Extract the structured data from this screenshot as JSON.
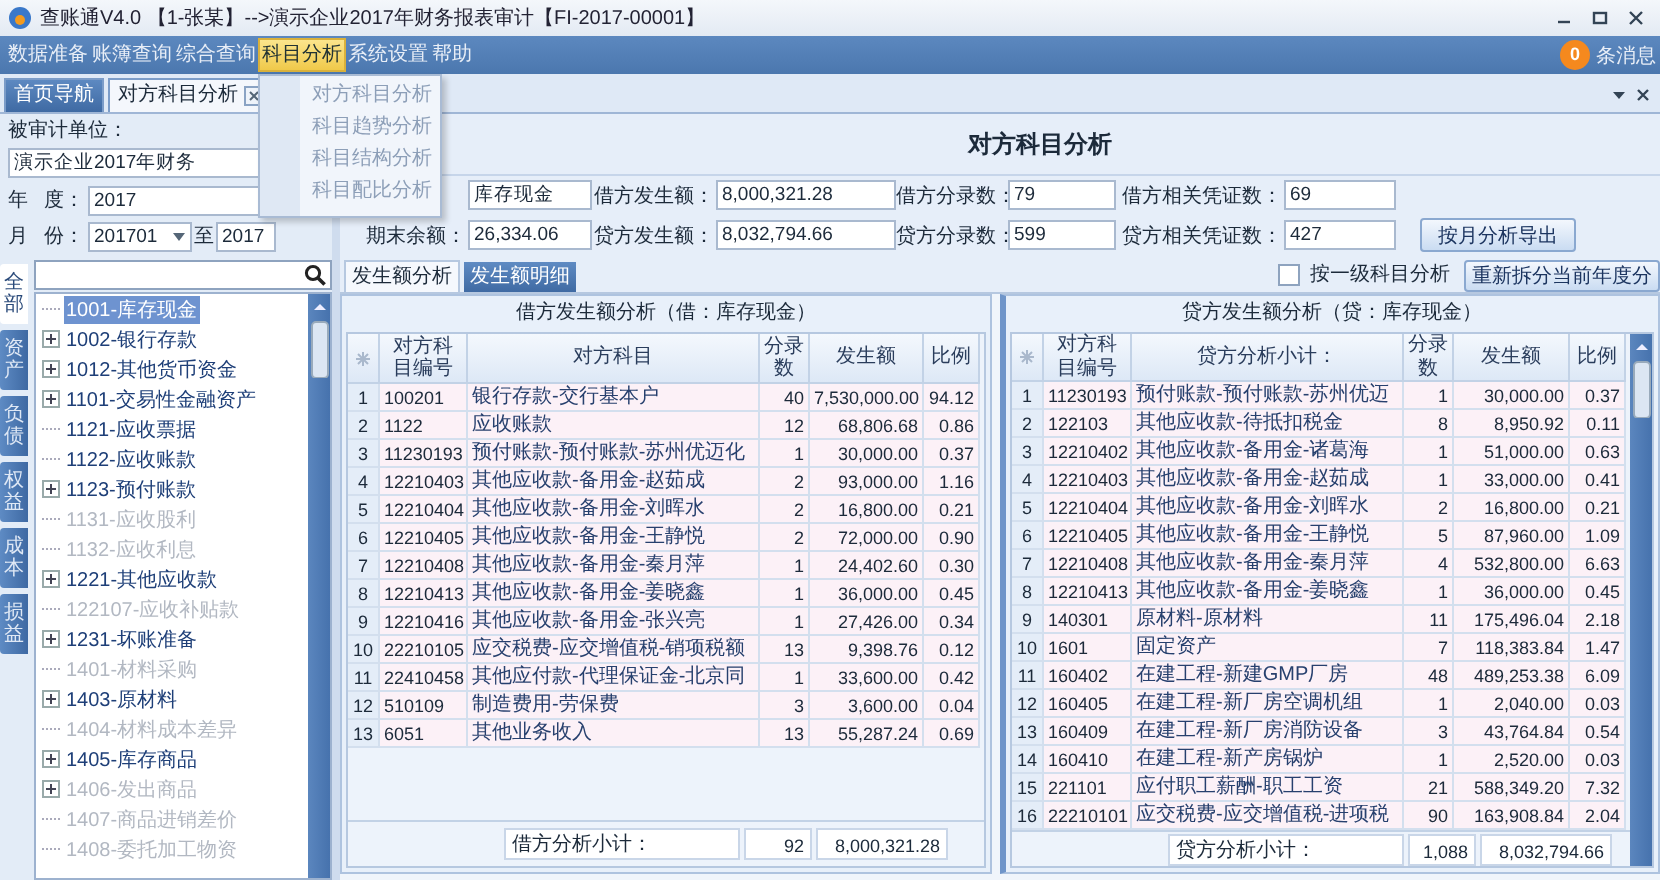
{
  "window": {
    "title": "查账通V4.0 【1-张某】-->演示企业2017年财务报表审计【FI-2017-00001】"
  },
  "menu": [
    {
      "label": "数据准备",
      "selected": false
    },
    {
      "label": "账簿查询",
      "selected": false
    },
    {
      "label": "综合查询",
      "selected": false
    },
    {
      "label": "科目分析",
      "selected": true
    },
    {
      "label": "系统设置",
      "selected": false
    },
    {
      "label": "帮助",
      "selected": false
    }
  ],
  "menu_dropdown": [
    "对方科目分析",
    "科目趋势分析",
    "科目结构分析",
    "科目配比分析"
  ],
  "messages": {
    "count": "0",
    "label": "条消息"
  },
  "doc_tabs": [
    {
      "label": "首页导航",
      "selected": false,
      "closable": false
    },
    {
      "label": "对方科目分析",
      "selected": true,
      "closable": true
    }
  ],
  "filters": {
    "unit": {
      "label": "被审计单位：",
      "value": "演示企业2017年财务"
    },
    "year": {
      "label_start": "年",
      "label_end": "度：",
      "value": "2017"
    },
    "month": {
      "label_start": "月",
      "label_end": "份：",
      "from": "201701",
      "separator": "至",
      "to": "2017"
    }
  },
  "category_tabs": [
    {
      "label": "全部",
      "selected": true
    },
    {
      "label": "资产",
      "selected": false
    },
    {
      "label": "负债",
      "selected": false
    },
    {
      "label": "权益",
      "selected": false
    },
    {
      "label": "成本",
      "selected": false
    },
    {
      "label": "损益",
      "selected": false
    }
  ],
  "tree": [
    {
      "label": "1001-库存现金",
      "expandable": false,
      "disabled": false,
      "selected": true
    },
    {
      "label": "1002-银行存款",
      "expandable": true,
      "disabled": false,
      "selected": false
    },
    {
      "label": "1012-其他货币资金",
      "expandable": true,
      "disabled": false,
      "selected": false
    },
    {
      "label": "1101-交易性金融资产",
      "expandable": true,
      "disabled": false,
      "selected": false
    },
    {
      "label": "1121-应收票据",
      "expandable": false,
      "disabled": false,
      "selected": false
    },
    {
      "label": "1122-应收账款",
      "expandable": false,
      "disabled": false,
      "selected": false
    },
    {
      "label": "1123-预付账款",
      "expandable": true,
      "disabled": false,
      "selected": false
    },
    {
      "label": "1131-应收股利",
      "expandable": false,
      "disabled": true,
      "selected": false
    },
    {
      "label": "1132-应收利息",
      "expandable": false,
      "disabled": true,
      "selected": false
    },
    {
      "label": "1221-其他应收款",
      "expandable": true,
      "disabled": false,
      "selected": false
    },
    {
      "label": "122107-应收补贴款",
      "expandable": false,
      "disabled": true,
      "selected": false
    },
    {
      "label": "1231-坏账准备",
      "expandable": true,
      "disabled": false,
      "selected": false
    },
    {
      "label": "1401-材料采购",
      "expandable": false,
      "disabled": true,
      "selected": false
    },
    {
      "label": "1403-原材料",
      "expandable": true,
      "disabled": false,
      "selected": false
    },
    {
      "label": "1404-材料成本差异",
      "expandable": false,
      "disabled": true,
      "selected": false
    },
    {
      "label": "1405-库存商品",
      "expandable": true,
      "disabled": false,
      "selected": false
    },
    {
      "label": "1406-发出商品",
      "expandable": true,
      "disabled": true,
      "selected": false
    },
    {
      "label": "1407-商品进销差价",
      "expandable": false,
      "disabled": true,
      "selected": false
    },
    {
      "label": "1408-委托加工物资",
      "expandable": false,
      "disabled": true,
      "selected": false
    }
  ],
  "analysis": {
    "title": "对方科目分析",
    "fields": [
      [
        {
          "value": "库存现金"
        },
        {
          "label": "借方发生额：",
          "value": "8,000,321.28"
        },
        {
          "label": "借方分录数：",
          "value": "79"
        },
        {
          "label": "借方相关凭证数：",
          "value": "69"
        }
      ],
      [
        {
          "label": "期末余额：",
          "value": "26,334.06"
        },
        {
          "label": "贷方发生额：",
          "value": "8,032,794.66"
        },
        {
          "label": "贷方分录数：",
          "value": "599"
        },
        {
          "label": "贷方相关凭证数：",
          "value": "427"
        }
      ]
    ],
    "export_button": "按月分析导出",
    "tabs": [
      {
        "label": "发生额分析",
        "selected": true
      },
      {
        "label": "发生额明细",
        "selected": false
      }
    ],
    "first_level_only": {
      "label": "按一级科目分析",
      "checked": false
    },
    "resplit_button": "重新拆分当前年度分"
  },
  "debit_table": {
    "title": "借方发生额分析（借：库存现金）",
    "columns": [
      "",
      "对方科目编号",
      "对方科目",
      "分录数",
      "发生额",
      "比例"
    ],
    "rows": [
      [
        "1",
        "100201",
        "银行存款-交行基本户",
        "40",
        "7,530,000.00",
        "94.12"
      ],
      [
        "2",
        "1122",
        "应收账款",
        "12",
        "68,806.68",
        "0.86"
      ],
      [
        "3",
        "11230193",
        "预付账款-预付账款-苏州优迈化",
        "1",
        "30,000.00",
        "0.37"
      ],
      [
        "4",
        "12210403",
        "其他应收款-备用金-赵茹成",
        "2",
        "93,000.00",
        "1.16"
      ],
      [
        "5",
        "12210404",
        "其他应收款-备用金-刘晖水",
        "2",
        "16,800.00",
        "0.21"
      ],
      [
        "6",
        "12210405",
        "其他应收款-备用金-王静悦",
        "2",
        "72,000.00",
        "0.90"
      ],
      [
        "7",
        "12210408",
        "其他应收款-备用金-秦月萍",
        "1",
        "24,402.60",
        "0.30"
      ],
      [
        "8",
        "12210413",
        "其他应收款-备用金-姜晓鑫",
        "1",
        "36,000.00",
        "0.45"
      ],
      [
        "9",
        "12210416",
        "其他应收款-备用金-张兴亮",
        "1",
        "27,426.00",
        "0.34"
      ],
      [
        "10",
        "22210105",
        "应交税费-应交增值税-销项税额",
        "13",
        "9,398.76",
        "0.12"
      ],
      [
        "11",
        "22410458",
        "其他应付款-代理保证金-北京同",
        "1",
        "33,600.00",
        "0.42"
      ],
      [
        "12",
        "510109",
        "制造费用-劳保费",
        "3",
        "3,600.00",
        "0.04"
      ],
      [
        "13",
        "6051",
        "其他业务收入",
        "13",
        "55,287.24",
        "0.69"
      ]
    ],
    "subtotal": {
      "label": "借方分析小计：",
      "count": "92",
      "amount": "8,000,321.28"
    }
  },
  "credit_table": {
    "title": "贷方发生额分析（贷：库存现金）",
    "columns": [
      "",
      "对方科目编号",
      "贷方分析小计：",
      "分录数",
      "发生额",
      "比例"
    ],
    "rows": [
      [
        "1",
        "11230193",
        "预付账款-预付账款-苏州优迈",
        "1",
        "30,000.00",
        "0.37"
      ],
      [
        "2",
        "122103",
        "其他应收款-待抵扣税金",
        "8",
        "8,950.92",
        "0.11"
      ],
      [
        "3",
        "12210402",
        "其他应收款-备用金-诸葛海",
        "1",
        "51,000.00",
        "0.63"
      ],
      [
        "4",
        "12210403",
        "其他应收款-备用金-赵茹成",
        "1",
        "33,000.00",
        "0.41"
      ],
      [
        "5",
        "12210404",
        "其他应收款-备用金-刘晖水",
        "2",
        "16,800.00",
        "0.21"
      ],
      [
        "6",
        "12210405",
        "其他应收款-备用金-王静悦",
        "5",
        "87,960.00",
        "1.09"
      ],
      [
        "7",
        "12210408",
        "其他应收款-备用金-秦月萍",
        "4",
        "532,800.00",
        "6.63"
      ],
      [
        "8",
        "12210413",
        "其他应收款-备用金-姜晓鑫",
        "1",
        "36,000.00",
        "0.45"
      ],
      [
        "9",
        "140301",
        "原材料-原材料",
        "11",
        "175,496.04",
        "2.18"
      ],
      [
        "10",
        "1601",
        "固定资产",
        "7",
        "118,383.84",
        "1.47"
      ],
      [
        "11",
        "160402",
        "在建工程-新建GMP厂房",
        "48",
        "489,253.38",
        "6.09"
      ],
      [
        "12",
        "160405",
        "在建工程-新厂房空调机组",
        "1",
        "2,040.00",
        "0.03"
      ],
      [
        "13",
        "160409",
        "在建工程-新厂房消防设备",
        "3",
        "43,764.84",
        "0.54"
      ],
      [
        "14",
        "160410",
        "在建工程-新产房锅炉",
        "1",
        "2,520.00",
        "0.03"
      ],
      [
        "15",
        "221101",
        "应付职工薪酬-职工工资",
        "21",
        "588,349.20",
        "7.32"
      ],
      [
        "16",
        "22210101",
        "应交税费-应交增值税-进项税",
        "90",
        "163,908.84",
        "2.04"
      ]
    ],
    "subtotal": {
      "label": "贷方分析小计：",
      "count": "1,088",
      "amount": "8,032,794.66"
    }
  }
}
